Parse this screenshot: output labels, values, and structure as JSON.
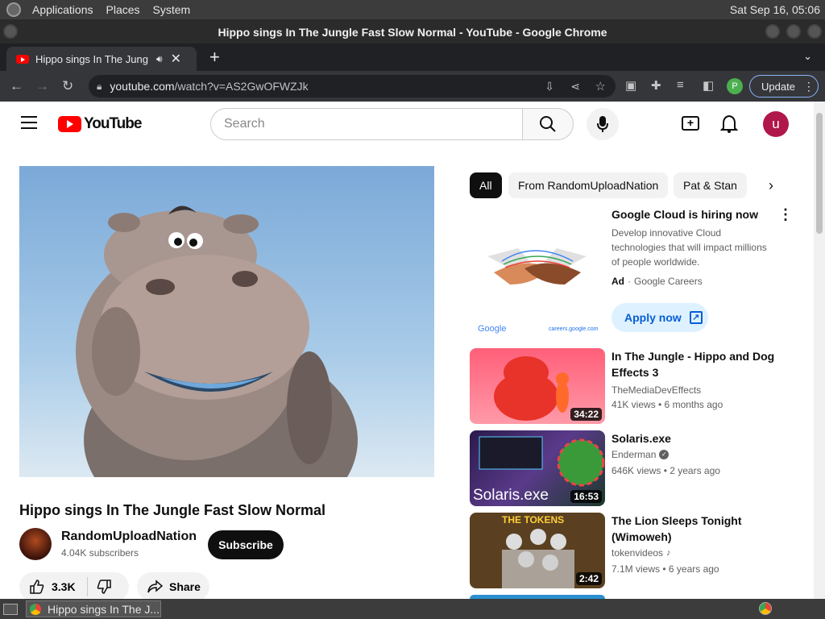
{
  "os": {
    "menu": [
      "Applications",
      "Places",
      "System"
    ],
    "clock": "Sat Sep 16, 05:06"
  },
  "window": {
    "title": "Hippo sings In The Jungle Fast Slow Normal - YouTube - Google Chrome"
  },
  "tab": {
    "title": "Hippo sings In The Jungle F"
  },
  "omnibox": {
    "domain": "youtube.com",
    "path": "/watch?v=AS2GwOFWZJk"
  },
  "toolbar": {
    "profile": "P",
    "update_label": "Update"
  },
  "yt": {
    "logo": "YouTube",
    "search_placeholder": "Search",
    "avatar": "u"
  },
  "chips": [
    "All",
    "From RandomUploadNation",
    "Pat & Stan"
  ],
  "video": {
    "title": "Hippo sings In The Jungle Fast Slow Normal",
    "channel": "RandomUploadNation",
    "subscribers": "4.04K subscribers",
    "subscribe_label": "Subscribe",
    "likes": "3.3K",
    "share_label": "Share"
  },
  "ad": {
    "title": "Google Cloud is hiring now",
    "desc": "Develop innovative Cloud technologies that will impact millions of people worldwide.",
    "badge": "Ad",
    "advertiser": "Google Careers",
    "cta": "Apply now",
    "logo_text": "Google",
    "url_text": "careers.google.com"
  },
  "recs": [
    {
      "title": "In The Jungle - Hippo and Dog Effects 3",
      "channel": "TheMediaDevEffects",
      "stats": "41K views • 6 months ago",
      "duration": "34:22"
    },
    {
      "title": "Solaris.exe",
      "channel": "Enderman",
      "stats": "646K views • 2 years ago",
      "duration": "16:53",
      "thumb_text": "Solaris.exe"
    },
    {
      "title": "The Lion Sleeps Tonight (Wimoweh)",
      "channel": "tokenvideos",
      "stats": "7.1M views • 6 years ago",
      "duration": "2:42",
      "thumb_text": "THE TOKENS"
    }
  ],
  "taskbar": {
    "window_label": "Hippo sings In The J..."
  }
}
